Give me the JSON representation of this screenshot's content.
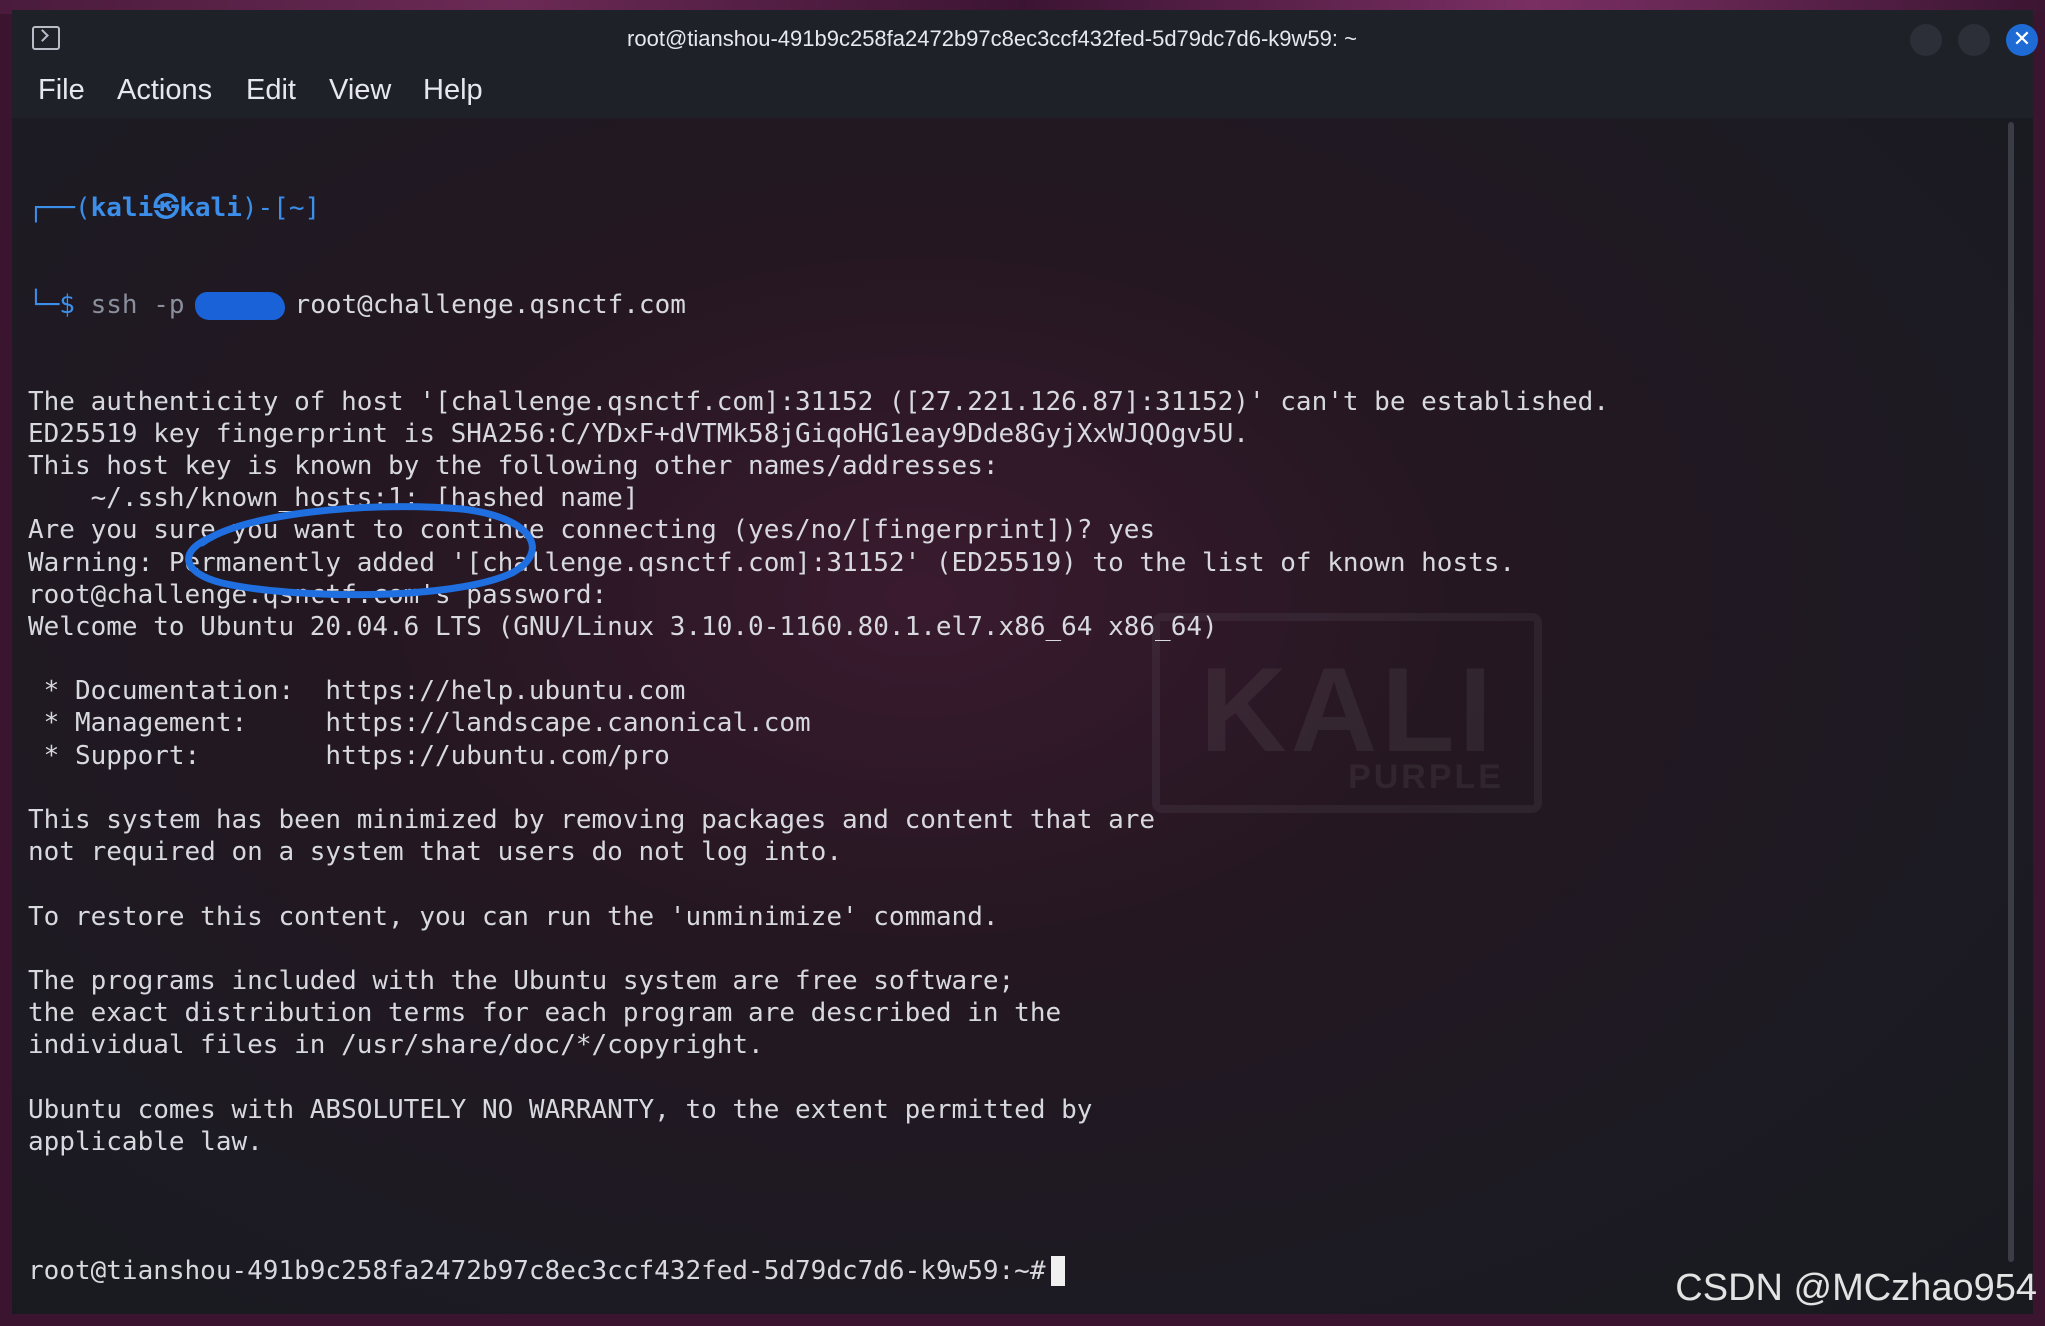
{
  "window": {
    "title": "root@tianshou-491b9c258fa2472b97c8ec3ccf432fed-5d79dc7d6-k9w59: ~",
    "close_symbol": "✕",
    "accent_color": "#1e6bd6"
  },
  "menu": {
    "items": [
      "File",
      "Actions",
      "Edit",
      "View",
      "Help"
    ]
  },
  "watermark": {
    "big": "KALI",
    "small": "PURPLE"
  },
  "terminal": {
    "prompt_header": {
      "prefix": "┌──(",
      "user_host": "kali㉿kali",
      "suffix": ")-[~]"
    },
    "command": {
      "prefix": "└─$ ",
      "cmd": "ssh -p",
      "target": "root@challenge.qsnctf.com"
    },
    "output_lines": [
      "The authenticity of host '[challenge.qsnctf.com]:31152 ([27.221.126.87]:31152)' can't be established.",
      "ED25519 key fingerprint is SHA256:C/YDxF+dVTMk58jGiqoHG1eay9Dde8GyjXxWJQOgv5U.",
      "This host key is known by the following other names/addresses:",
      "    ~/.ssh/known_hosts:1: [hashed name]",
      "Are you sure you want to continue connecting (yes/no/[fingerprint])? yes",
      "Warning: Permanently added '[challenge.qsnctf.com]:31152' (ED25519) to the list of known hosts.",
      "root@challenge.qsnctf.com's password:",
      "Welcome to Ubuntu 20.04.6 LTS (GNU/Linux 3.10.0-1160.80.1.el7.x86_64 x86_64)",
      "",
      " * Documentation:  https://help.ubuntu.com",
      " * Management:     https://landscape.canonical.com",
      " * Support:        https://ubuntu.com/pro",
      "",
      "This system has been minimized by removing packages and content that are",
      "not required on a system that users do not log into.",
      "",
      "To restore this content, you can run the 'unminimize' command.",
      "",
      "The programs included with the Ubuntu system are free software;",
      "the exact distribution terms for each program are described in the",
      "individual files in /usr/share/doc/*/copyright.",
      "",
      "Ubuntu comes with ABSOLUTELY NO WARRANTY, to the extent permitted by",
      "applicable law.",
      ""
    ],
    "final_prompt": "root@tianshou-491b9c258fa2472b97c8ec3ccf432fed-5d79dc7d6-k9w59:~#",
    "prompt_color": "#3b8eea",
    "text_color": "#d7d9de"
  },
  "credit": "CSDN @MCzhao954"
}
